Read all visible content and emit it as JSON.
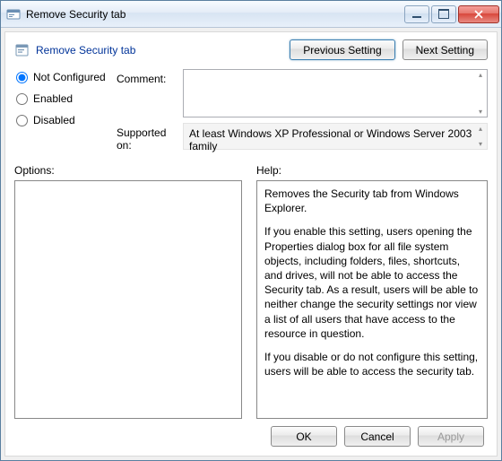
{
  "window": {
    "title": "Remove Security tab"
  },
  "header": {
    "title": "Remove Security tab",
    "prev_label": "Previous Setting",
    "next_label": "Next Setting"
  },
  "state": {
    "not_configured_label": "Not Configured",
    "enabled_label": "Enabled",
    "disabled_label": "Disabled",
    "selected": "not_configured"
  },
  "labels": {
    "comment": "Comment:",
    "supported": "Supported on:",
    "options": "Options:",
    "help": "Help:"
  },
  "comment": "",
  "supported_on": "At least Windows XP Professional or Windows Server 2003 family",
  "help": {
    "p1": "Removes the Security tab from Windows Explorer.",
    "p2": "If you enable this setting, users opening the Properties dialog box for all file system objects, including folders, files, shortcuts, and drives, will not be able to access the Security tab. As a result, users will be able to neither change the security settings nor view a list of all users that have access to the resource in question.",
    "p3": "If you disable or do not configure this setting, users will be able to access the security tab."
  },
  "footer": {
    "ok": "OK",
    "cancel": "Cancel",
    "apply": "Apply"
  }
}
